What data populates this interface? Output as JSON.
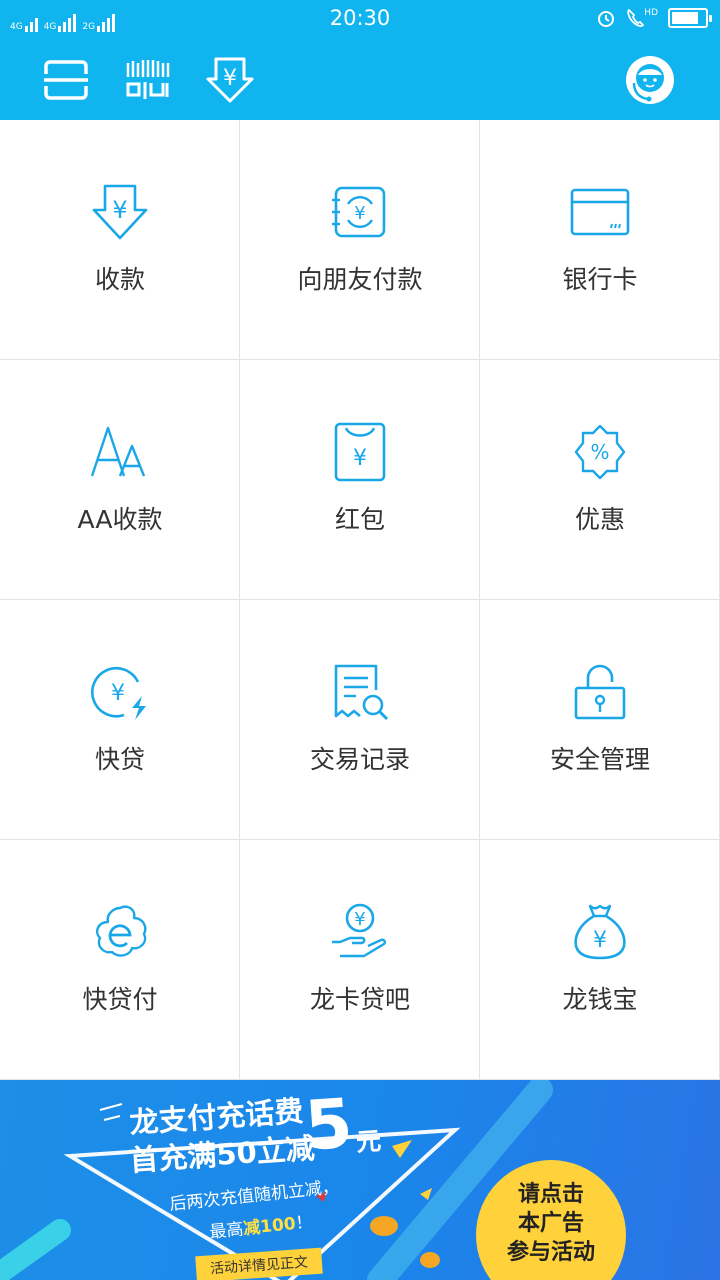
{
  "status_bar": {
    "net1": "4G",
    "net2": "4G",
    "net3": "2G",
    "time": "20:30",
    "hd": "HD",
    "battery_level": 0.82
  },
  "toolbar": {
    "icons": [
      "scan-icon",
      "qr-pay-icon",
      "receive-yuan-icon",
      "customer-service-icon"
    ]
  },
  "grid": {
    "items": [
      {
        "label": "收款",
        "icon": "receive-yuan-icon"
      },
      {
        "label": "向朋友付款",
        "icon": "transfer-friend-icon"
      },
      {
        "label": "银行卡",
        "icon": "bank-card-icon"
      },
      {
        "label": "AA收款",
        "icon": "aa-icon"
      },
      {
        "label": "红包",
        "icon": "red-packet-icon"
      },
      {
        "label": "优惠",
        "icon": "discount-icon"
      },
      {
        "label": "快贷",
        "icon": "quick-loan-icon"
      },
      {
        "label": "交易记录",
        "icon": "transaction-record-icon"
      },
      {
        "label": "安全管理",
        "icon": "security-lock-icon"
      },
      {
        "label": "快贷付",
        "icon": "quick-loan-pay-icon"
      },
      {
        "label": "龙卡贷吧",
        "icon": "card-loan-icon"
      },
      {
        "label": "龙钱宝",
        "icon": "money-bag-icon"
      }
    ]
  },
  "banner": {
    "title_line1": "龙支付充话费",
    "title_line2": "首充满50立减",
    "amount": "5",
    "unit": "元",
    "sub_line1": "后两次充值随机立减，",
    "sub_line2_prefix": "最高",
    "sub_line2_highlight": "减100",
    "sub_line2_suffix": "！",
    "tag": "活动详情见正文",
    "cta_line1": "请点击",
    "cta_line2": "本广告",
    "cta_line3": "参与活动",
    "colors": {
      "accent": "#ffd13a",
      "background": "#1a86ea"
    }
  },
  "colors": {
    "primary": "#10b4ef",
    "icon": "#1aa7e8",
    "divider": "#e3e3e3",
    "label": "#333333"
  }
}
